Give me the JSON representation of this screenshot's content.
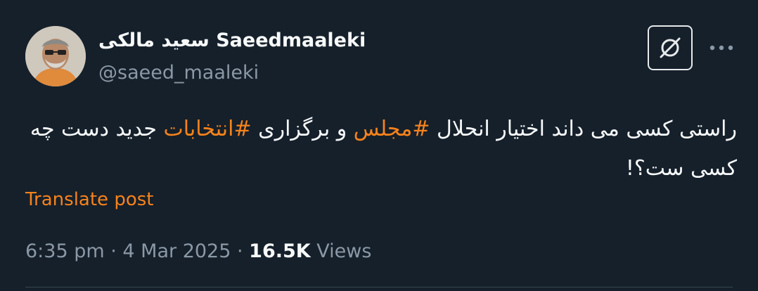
{
  "author": {
    "display_name": "سعید مالکی Saeedmaaleki",
    "handle": "@saeed_maaleki"
  },
  "header": {
    "grok_icon": "grok-slash-icon",
    "more_icon": "ellipsis-icon"
  },
  "post": {
    "text_part1": "راستی کسی می داند اختیار انحلال ",
    "hashtag1": "#مجلس",
    "text_part2": " و برگزاری ",
    "hashtag2": "#انتخابات",
    "text_part3": " جدید دست چه کسی ست؟!",
    "translate_label": "Translate post"
  },
  "meta": {
    "time": "6:35 pm",
    "sep1": " · ",
    "date": "4 Mar 2025",
    "sep2": " · ",
    "views_count": "16.5K",
    "views_label": " Views"
  },
  "colors": {
    "background": "#15202b",
    "accent": "#f7821b",
    "muted": "#8b98a5",
    "text": "#f7f9f9"
  }
}
